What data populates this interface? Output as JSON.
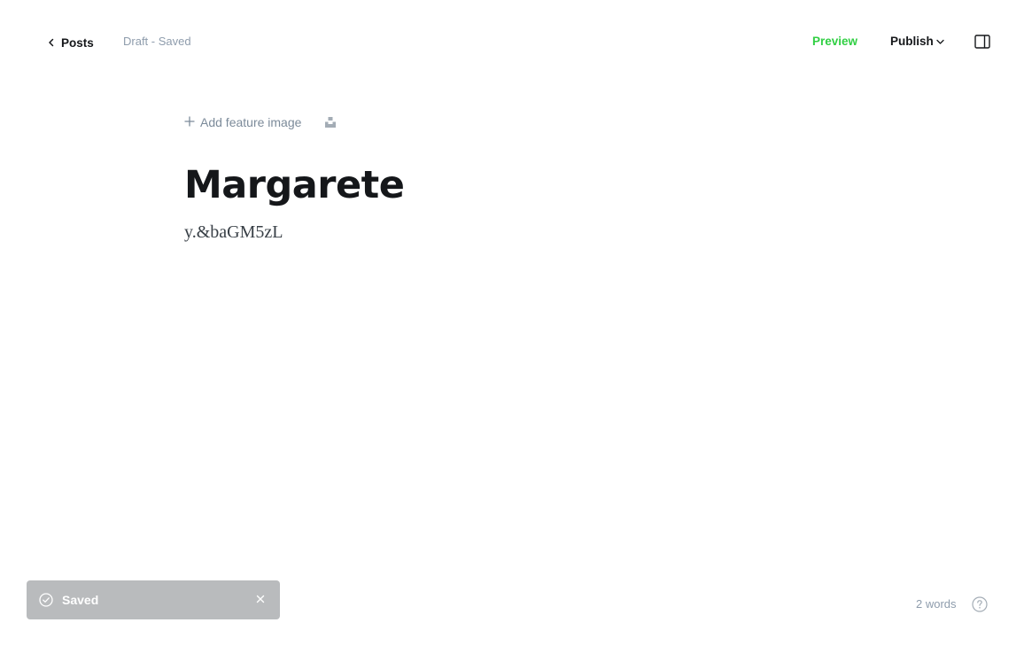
{
  "header": {
    "back_label": "Posts",
    "status": "Draft - Saved",
    "preview_label": "Preview",
    "publish_label": "Publish"
  },
  "editor": {
    "add_feature_label": "Add feature image",
    "title": "Margarete",
    "body": "y.&baGM5zL"
  },
  "toast": {
    "message": "Saved"
  },
  "footer": {
    "word_count": "2 words"
  },
  "colors": {
    "accent_green": "#30cf43",
    "text_dark": "#15171a",
    "text_muted": "#8e9cac",
    "toast_bg": "#b9bbbd"
  },
  "icons": {
    "back": "chevron-left-icon",
    "publish_dropdown": "chevron-down-icon",
    "sidebar": "sidebar-toggle-icon",
    "add": "plus-icon",
    "unsplash": "unsplash-icon",
    "toast": "check-circle-icon",
    "close": "close-icon",
    "help": "help-circle-icon"
  }
}
